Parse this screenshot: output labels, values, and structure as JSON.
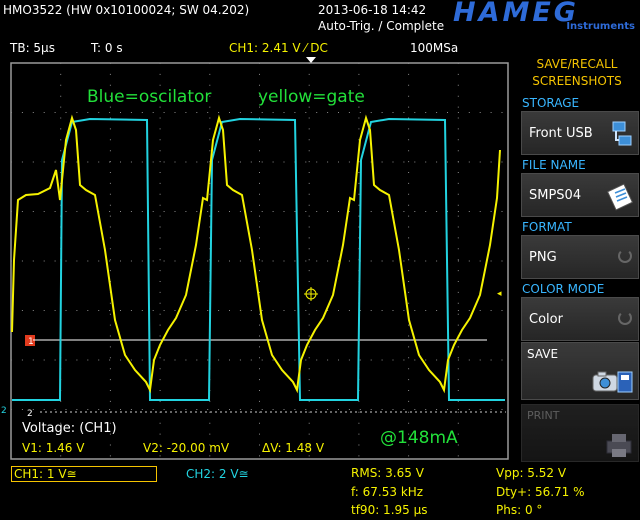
{
  "header": {
    "model": "HMO3522 (HW 0x10100024; SW 04.202)",
    "datetime": "2013-06-18 14:42",
    "trigger_status": "Auto-Trig. / Complete",
    "brand": "HAMEG",
    "brand_sub": "Instruments"
  },
  "status_bar": {
    "timebase": "TB: 5µs",
    "trigger_time": "T: 0 s",
    "trigger_level": "CH1: 2.41 V ⁄ DC",
    "sample_rate": "100MSa"
  },
  "annotations": {
    "blue_label": "Blue=oscilator",
    "yellow_label": "yellow=gate",
    "current": "@148mA"
  },
  "cursor_readout": {
    "title": "Voltage: (CH1)",
    "v1": "V1: 1.46 V",
    "v2": "V2: -20.00 mV",
    "dv": "ΔV: 1.48 V"
  },
  "markers": {
    "ch1": "1",
    "ch2": "2"
  },
  "bottom": {
    "ch1_scale": "CH1: 1 V≅",
    "ch2_scale": "CH2: 2 V≅",
    "rms": "RMS: 3.65 V",
    "freq": "f: 67.53 kHz",
    "tf90": "tf90: 1.95 µs",
    "vpp": "Vpp: 5.52 V",
    "duty": "Dty+: 56.71 %",
    "phase": "Phs: 0 °"
  },
  "menu": {
    "title_line1": "SAVE/RECALL",
    "title_line2": "SCREENSHOTS",
    "storage_label": "STORAGE",
    "storage_value": "Front USB",
    "filename_label": "FILE NAME",
    "filename_value": "SMPS04",
    "format_label": "FORMAT",
    "format_value": "PNG",
    "colormode_label": "COLOR MODE",
    "colormode_value": "Color",
    "save_label": "SAVE",
    "print_label": "PRINT"
  },
  "colors": {
    "ch1": "#f5f200",
    "ch2": "#22d3e0",
    "annotation": "#22e03a",
    "menu_title": "#f5c400",
    "menu_label": "#39b6ff"
  }
}
